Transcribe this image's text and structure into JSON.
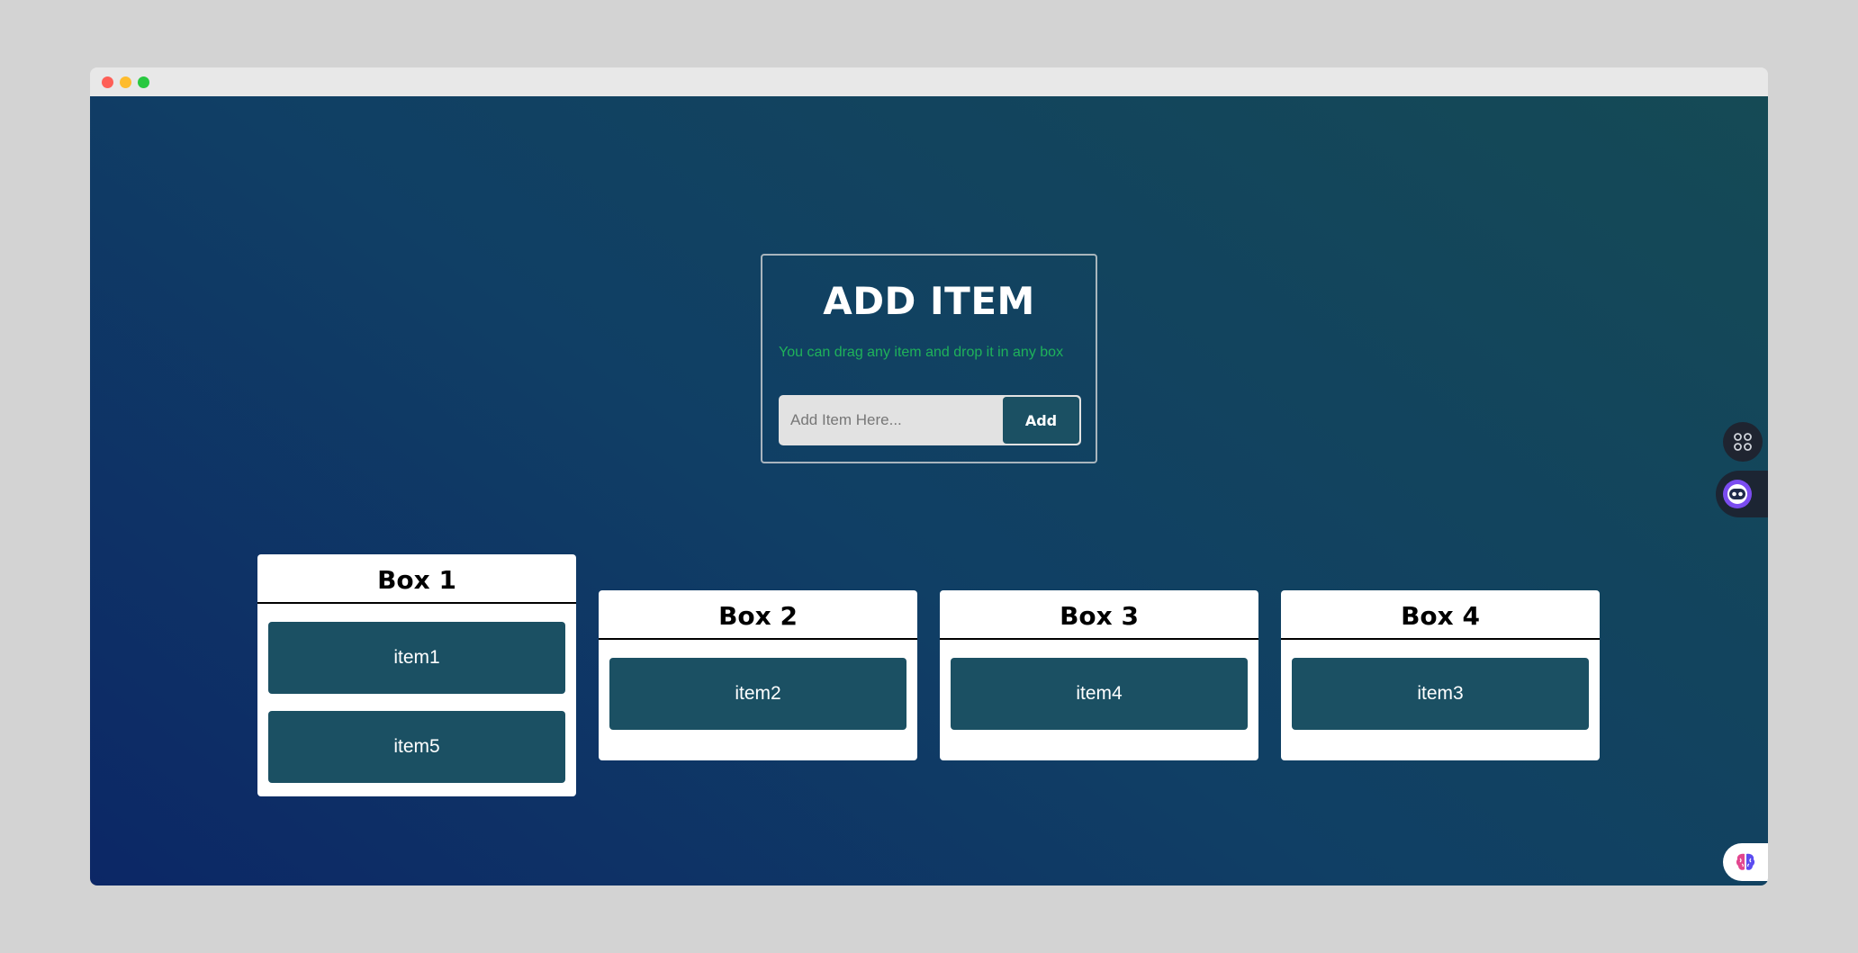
{
  "window": {
    "controls": [
      "close",
      "minimize",
      "zoom"
    ]
  },
  "add_card": {
    "title": "ADD ITEM",
    "hint": "You can drag any item and drop it in any box",
    "input_placeholder": "Add Item Here...",
    "input_value": "",
    "button_label": "Add"
  },
  "boxes": [
    {
      "title": "Box 1",
      "items": [
        "item1",
        "item5"
      ]
    },
    {
      "title": "Box 2",
      "items": [
        "item2"
      ]
    },
    {
      "title": "Box 3",
      "items": [
        "item4"
      ]
    },
    {
      "title": "Box 4",
      "items": [
        "item3"
      ]
    }
  ],
  "extensions": {
    "tool_icon": "command-icon",
    "assistant_icon": "robot-face-icon",
    "brain_icon": "brain-icon"
  },
  "colors": {
    "item_bg": "#1b5063",
    "hint_text": "#1fb25a",
    "bg_start": "#0c2766",
    "bg_end": "#154a55"
  }
}
